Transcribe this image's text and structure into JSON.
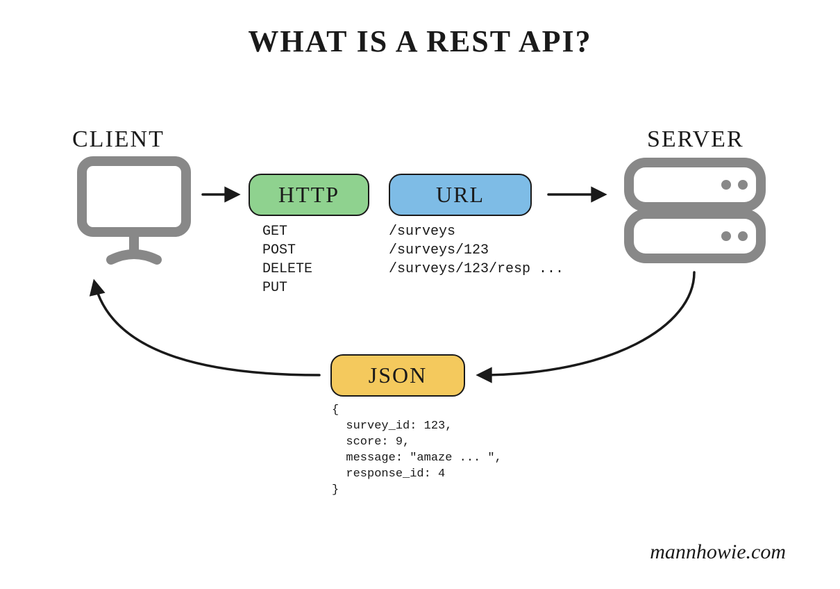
{
  "title": "WHAT IS A REST API?",
  "client_label": "CLIENT",
  "server_label": "SERVER",
  "http": {
    "pill": "HTTP",
    "methods": "GET\nPOST\nDELETE\nPUT"
  },
  "url": {
    "pill": "URL",
    "paths": "/surveys\n/surveys/123\n/surveys/123/resp ..."
  },
  "json": {
    "pill": "JSON",
    "body": "{\n  survey_id: 123,\n  score: 9,\n  message: \"amaze ... \",\n  response_id: 4\n}"
  },
  "credit": "mannhowie.com",
  "colors": {
    "http_fill": "#8fd28f",
    "url_fill": "#7ebce6",
    "json_fill": "#f4c95d",
    "icon_gray": "#888888",
    "stroke": "#1a1a1a"
  }
}
